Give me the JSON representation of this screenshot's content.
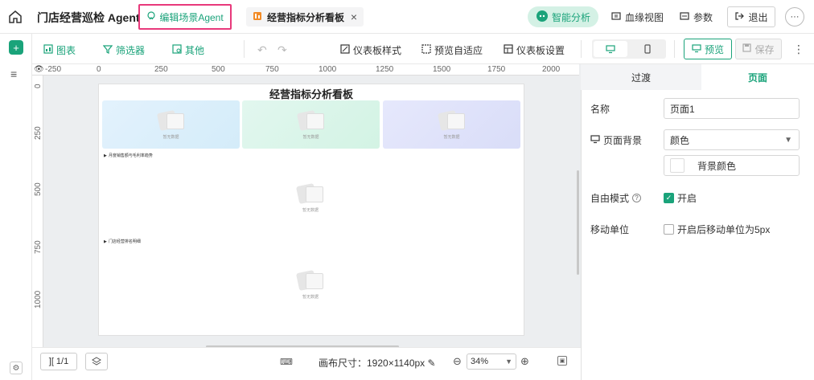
{
  "header": {
    "app_title": "门店经营巡检 Agent",
    "edit_agent_label": "编辑场景Agent",
    "active_tab_label": "经营指标分析看板",
    "close_glyph": "×",
    "smart_analysis_label": "智能分析",
    "lineage_label": "血缘视图",
    "params_label": "参数",
    "exit_label": "退出",
    "more_glyph": "···"
  },
  "toolbar": {
    "chart_label": "图表",
    "filter_label": "筛选器",
    "other_label": "其他",
    "dashboard_style_label": "仪表板样式",
    "preview_fit_label": "预览自适应",
    "dashboard_settings_label": "仪表板设置",
    "preview_label": "预览",
    "save_label": "保存"
  },
  "ruler": {
    "h_labels": [
      "-250",
      "0",
      "250",
      "500",
      "750",
      "1000",
      "1250",
      "1500",
      "1750",
      "2000"
    ],
    "v_labels": [
      "0",
      "250",
      "500",
      "750",
      "1000"
    ]
  },
  "canvas": {
    "page_title": "经营指标分析看板",
    "placeholder_text": "暂无数据",
    "section1_label": "月度销售额与毛利率趋势",
    "section2_label": "门店经营排名明细"
  },
  "bottom": {
    "page_indicator": "1/1",
    "canvas_size_label": "画布尺寸：1920×1140px",
    "zoom_value": "34%"
  },
  "panel": {
    "tab_transition": "过渡",
    "tab_page": "页面",
    "name_label": "名称",
    "name_value": "页面1",
    "bg_label": "页面背景",
    "bg_value": "颜色",
    "bg_color_label": "背景颜色",
    "free_mode_label": "自由模式",
    "free_mode_check_label": "开启",
    "move_unit_label": "移动单位",
    "move_unit_check_label": "开启后移动单位为5px"
  },
  "colors": {
    "accent": "#1aa37a",
    "highlight_border": "#e8397b",
    "card1": "#dff0fb",
    "card2": "#dbf6ea",
    "card3": "#e1e4fb"
  }
}
